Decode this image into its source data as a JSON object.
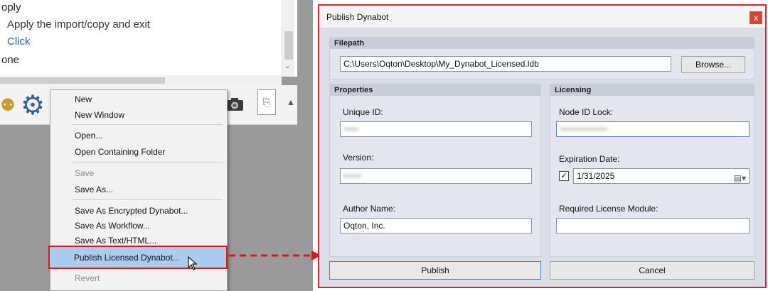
{
  "background_app": {
    "lines": [
      "oply",
      "Apply the import/copy and exit",
      "Click",
      "one"
    ],
    "toolbar_icons": [
      "people-icon",
      "gear-icon",
      "camera-icon",
      "document-icon",
      "overflow-arrow-icon"
    ]
  },
  "context_menu": {
    "items": [
      {
        "label": "New",
        "enabled": true
      },
      {
        "label": "New Window",
        "enabled": true
      },
      {
        "label": "Open...",
        "enabled": true
      },
      {
        "label": "Open Containing Folder",
        "enabled": true
      },
      {
        "label": "Save",
        "enabled": false
      },
      {
        "label": "Save As...",
        "enabled": true
      },
      {
        "label": "Save As Encrypted Dynabot...",
        "enabled": true
      },
      {
        "label": "Save As Workflow...",
        "enabled": true
      },
      {
        "label": "Save As Text/HTML...",
        "enabled": true
      },
      {
        "label": "Publish Licensed Dynabot...",
        "enabled": true,
        "highlighted": true
      },
      {
        "label": "Revert",
        "enabled": false
      }
    ]
  },
  "dialog": {
    "title": "Publish Dynabot",
    "close_label": "x",
    "filepath": {
      "header": "Filepath",
      "value": "C:\\Users\\Oqton\\Desktop\\My_Dynabot_Licensed.ldb",
      "browse_label": "Browse..."
    },
    "properties": {
      "header": "Properties",
      "unique_id_label": "Unique ID:",
      "unique_id_value": "•••••",
      "version_label": "Version:",
      "version_value": "••••••",
      "author_label": "Author Name:",
      "author_value": "Oqton, Inc."
    },
    "licensing": {
      "header": "Licensing",
      "node_id_label": "Node ID Lock:",
      "node_id_value": "••••••••••••••••",
      "expiration_label": "Expiration Date:",
      "expiration_checked": true,
      "expiration_value": "1/31/2025",
      "module_label": "Required License Module:",
      "module_value": ""
    },
    "publish_label": "Publish",
    "cancel_label": "Cancel"
  },
  "colors": {
    "highlight_border": "#d11c1c",
    "menu_highlight_bg": "#aacdee",
    "dialog_bg": "#d9dde6",
    "link_blue": "#2a5fb5"
  }
}
